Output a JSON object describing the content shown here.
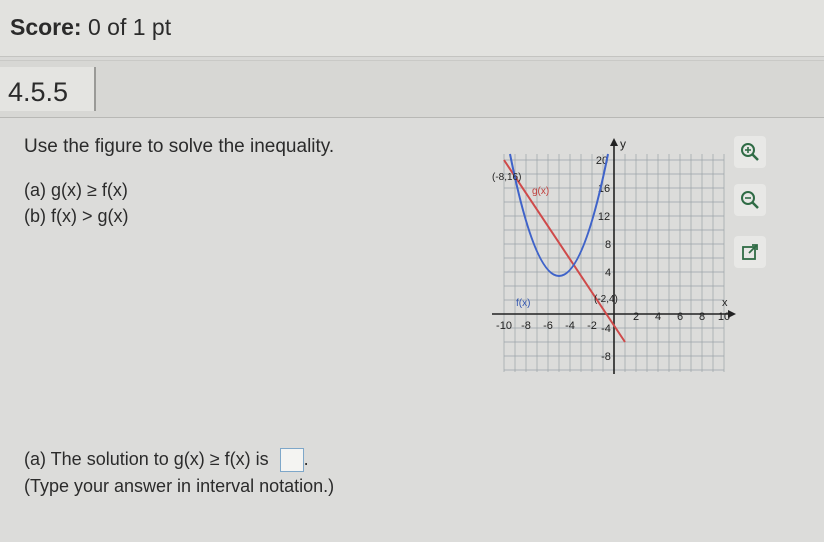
{
  "score": {
    "label": "Score:",
    "value": "0 of 1 pt"
  },
  "question_number": "4.5.5",
  "instruction": "Use the figure to solve the inequality.",
  "parts": [
    {
      "label": "(a) g(x) ≥ f(x)"
    },
    {
      "label": "(b) f(x) > g(x)"
    }
  ],
  "graph": {
    "x_axis_label": "x",
    "y_axis_label": "y",
    "x_ticks": [
      "-10",
      "-8",
      "-6",
      "-4",
      "-2",
      "2",
      "4",
      "6",
      "8",
      "10"
    ],
    "y_ticks": [
      "20",
      "16",
      "12",
      "8",
      "4",
      "-4",
      "-8"
    ],
    "point_labels": [
      "(-8,16)",
      "(-2,4)"
    ],
    "curve_labels": {
      "f": "f(x)",
      "g": "g(x)"
    },
    "colors": {
      "f": "#3f63c9",
      "g": "#d04a4a"
    }
  },
  "tools": [
    {
      "name": "zoom-in-icon"
    },
    {
      "name": "zoom-out-icon"
    },
    {
      "name": "open-new-window-icon"
    }
  ],
  "answer": {
    "prompt": "(a) The solution to g(x) ≥ f(x) is",
    "suffix": ".",
    "hint": "(Type your answer in interval notation.)"
  }
}
